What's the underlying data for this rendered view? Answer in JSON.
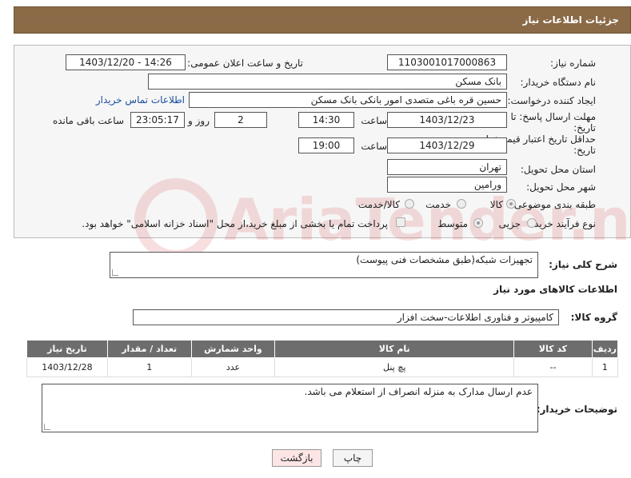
{
  "header": {
    "title": "جزئیات اطلاعات نیاز"
  },
  "form": {
    "need_number": {
      "label": "شماره نیاز:",
      "value": "1103001017000863"
    },
    "announce_datetime": {
      "label": "تاریخ و ساعت اعلان عمومی:",
      "value": "1403/12/20 - 14:26"
    },
    "buyer_org": {
      "label": "نام دستگاه خریدار:",
      "value": "بانک مسکن"
    },
    "requester": {
      "label": "ایجاد کننده درخواست:",
      "value": "حسین  قره باغی متصدی امور بانکی بانک مسکن",
      "contact_link": "اطلاعات تماس خریدار"
    },
    "reply_deadline": {
      "label_line1": "مهلت ارسال پاسخ: تا",
      "label_line2": "تاریخ:",
      "date": "1403/12/23",
      "time_label": "ساعت",
      "time": "14:30",
      "days": "2",
      "days_label": "روز و",
      "remaining": "23:05:17",
      "remaining_label": "ساعت باقی مانده"
    },
    "price_validity": {
      "label_line1": "حداقل تاریخ اعتبار قیمت: تا",
      "label_line2": "تاریخ:",
      "date": "1403/12/29",
      "time_label": "ساعت",
      "time": "19:00"
    },
    "province": {
      "label": "استان محل تحویل:",
      "value": "تهران"
    },
    "city": {
      "label": "شهر محل تحویل:",
      "value": "ورامین"
    },
    "category": {
      "label": "طبقه بندی موضوعی:",
      "options": [
        "کالا",
        "خدمت",
        "کالا/خدمت"
      ],
      "selected": "کالا"
    },
    "process_type": {
      "label": "نوع فرآیند خرید :",
      "options": [
        "جزیی",
        "متوسط"
      ],
      "payment_note": "پرداخت تمام یا بخشی از مبلغ خرید،از محل \"اسناد خزانه اسلامی\" خواهد بود."
    }
  },
  "description": {
    "label": "شرح کلی نیاز:",
    "value": "تجهیزات شبکه(طبق مشخصات فنی پیوست)"
  },
  "goods_section": {
    "title": "اطلاعات کالاهای مورد نیاز",
    "group_label": "گروه کالا:",
    "group_value": "کامپیوتر و فناوری اطلاعات-سخت افزار"
  },
  "table": {
    "headers": [
      "ردیف",
      "کد کالا",
      "نام کالا",
      "واحد شمارش",
      "تعداد / مقدار",
      "تاریخ نیاز"
    ],
    "rows": [
      [
        "1",
        "--",
        "پچ پنل",
        "عدد",
        "1",
        "1403/12/28"
      ]
    ]
  },
  "buyer_notes": {
    "label": "توضیحات خریدار:",
    "value": "عدم ارسال مدارک به منزله انصراف از استعلام می باشد."
  },
  "buttons": {
    "print": "چاپ",
    "back": "بازگشت"
  },
  "watermark": "AriaTender.neT"
}
